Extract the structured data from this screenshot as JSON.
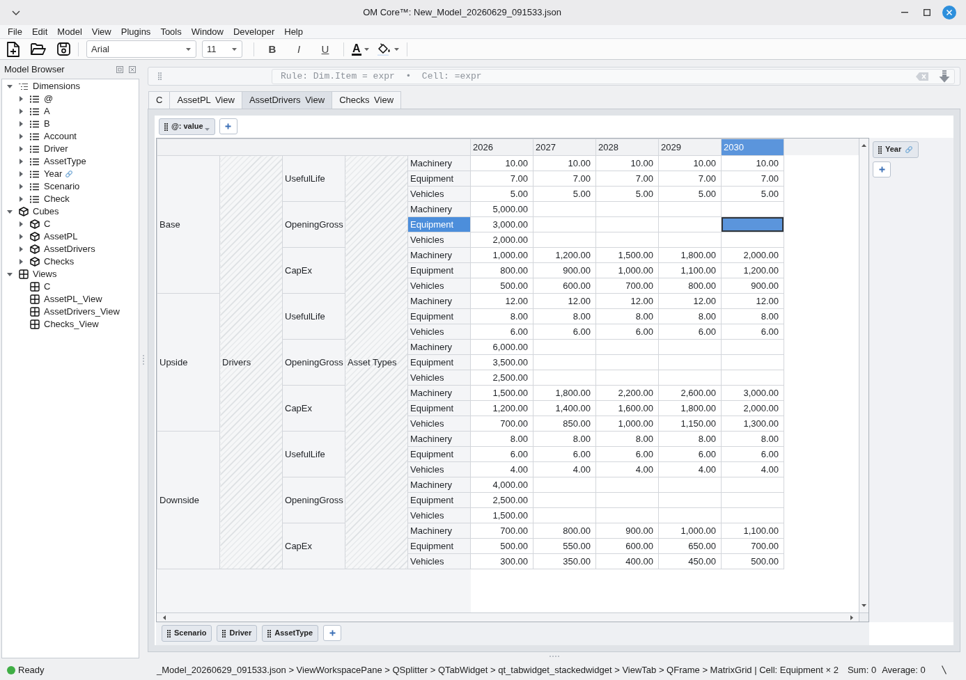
{
  "window": {
    "title": "OM Core™: New_Model_20260629_091533.json"
  },
  "menu": [
    "File",
    "Edit",
    "Model",
    "View",
    "Plugins",
    "Tools",
    "Window",
    "Developer",
    "Help"
  ],
  "toolbar": {
    "font_family": "Arial",
    "font_size": "11",
    "format_buttons": [
      {
        "label": "B",
        "kind": "bold"
      },
      {
        "label": "I",
        "kind": "italic"
      },
      {
        "label": "U",
        "kind": "underline"
      }
    ],
    "text_color_label": "A"
  },
  "model_browser": {
    "title": "Model Browser",
    "tree": [
      {
        "label": "Dimensions",
        "kind": "dimension-group",
        "expanded": true,
        "children": [
          {
            "label": "@",
            "kind": "dimension",
            "expanded": false,
            "linked": false
          },
          {
            "label": "A",
            "kind": "dimension",
            "expanded": false,
            "linked": false
          },
          {
            "label": "B",
            "kind": "dimension",
            "expanded": false,
            "linked": false
          },
          {
            "label": "Account",
            "kind": "dimension",
            "expanded": false,
            "linked": false
          },
          {
            "label": "Driver",
            "kind": "dimension",
            "expanded": false,
            "linked": false
          },
          {
            "label": "AssetType",
            "kind": "dimension",
            "expanded": false,
            "linked": false
          },
          {
            "label": "Year",
            "kind": "dimension",
            "expanded": false,
            "linked": true
          },
          {
            "label": "Scenario",
            "kind": "dimension",
            "expanded": false,
            "linked": false
          },
          {
            "label": "Check",
            "kind": "dimension",
            "expanded": false,
            "linked": false
          }
        ]
      },
      {
        "label": "Cubes",
        "kind": "cube-group",
        "expanded": true,
        "children": [
          {
            "label": "C",
            "kind": "cube",
            "expanded": false
          },
          {
            "label": "AssetPL",
            "kind": "cube",
            "expanded": false
          },
          {
            "label": "AssetDrivers",
            "kind": "cube",
            "expanded": false
          },
          {
            "label": "Checks",
            "kind": "cube",
            "expanded": false
          }
        ]
      },
      {
        "label": "Views",
        "kind": "view-group",
        "expanded": true,
        "children": [
          {
            "label": "C",
            "kind": "view"
          },
          {
            "label": "AssetPL_View",
            "kind": "view"
          },
          {
            "label": "AssetDrivers_View",
            "kind": "view"
          },
          {
            "label": "Checks_View",
            "kind": "view"
          }
        ]
      }
    ]
  },
  "rule_bar": {
    "placeholder": "Rule: Dim.Item = expr  •  Cell: =expr"
  },
  "tabs": [
    {
      "label": "C",
      "selected": false
    },
    {
      "label": "AssetPL View",
      "selected": false
    },
    {
      "label": "AssetDrivers View",
      "selected": true
    },
    {
      "label": "Checks View",
      "selected": false
    }
  ],
  "view": {
    "filters": [
      {
        "label": "@: value"
      }
    ],
    "column_dimensions": [
      {
        "label": "Year",
        "linked": true
      }
    ],
    "row_dimensions": [
      {
        "label": "Scenario",
        "linked": false
      },
      {
        "label": "Driver",
        "linked": false
      },
      {
        "label": "AssetType",
        "linked": false
      }
    ],
    "grid": {
      "columns": [
        {
          "label": "2026",
          "selected": false
        },
        {
          "label": "2027",
          "selected": false
        },
        {
          "label": "2028",
          "selected": false
        },
        {
          "label": "2029",
          "selected": false
        },
        {
          "label": "2030",
          "selected": true
        }
      ],
      "spanning_labels": [
        "Drivers",
        "Asset Types"
      ],
      "scenarios": [
        {
          "label": "Base",
          "drivers": [
            {
              "label": "UsefulLife",
              "rows": [
                {
                  "label": "Machinery",
                  "selected": false,
                  "values": [
                    "10.00",
                    "10.00",
                    "10.00",
                    "10.00",
                    "10.00"
                  ]
                },
                {
                  "label": "Equipment",
                  "selected": false,
                  "values": [
                    "7.00",
                    "7.00",
                    "7.00",
                    "7.00",
                    "7.00"
                  ]
                },
                {
                  "label": "Vehicles",
                  "selected": false,
                  "values": [
                    "5.00",
                    "5.00",
                    "5.00",
                    "5.00",
                    "5.00"
                  ]
                }
              ]
            },
            {
              "label": "OpeningGross",
              "rows": [
                {
                  "label": "Machinery",
                  "selected": false,
                  "values": [
                    "5,000.00"
                  ]
                },
                {
                  "label": "Equipment",
                  "selected": true,
                  "values": [
                    "3,000.00"
                  ]
                },
                {
                  "label": "Vehicles",
                  "selected": false,
                  "values": [
                    "2,000.00"
                  ]
                }
              ]
            },
            {
              "label": "CapEx",
              "rows": [
                {
                  "label": "Machinery",
                  "selected": false,
                  "values": [
                    "1,000.00",
                    "1,200.00",
                    "1,500.00",
                    "1,800.00",
                    "2,000.00"
                  ]
                },
                {
                  "label": "Equipment",
                  "selected": false,
                  "values": [
                    "800.00",
                    "900.00",
                    "1,000.00",
                    "1,100.00",
                    "1,200.00"
                  ]
                },
                {
                  "label": "Vehicles",
                  "selected": false,
                  "values": [
                    "500.00",
                    "600.00",
                    "700.00",
                    "800.00",
                    "900.00"
                  ]
                }
              ]
            }
          ]
        },
        {
          "label": "Upside",
          "drivers": [
            {
              "label": "UsefulLife",
              "rows": [
                {
                  "label": "Machinery",
                  "selected": false,
                  "values": [
                    "12.00",
                    "12.00",
                    "12.00",
                    "12.00",
                    "12.00"
                  ]
                },
                {
                  "label": "Equipment",
                  "selected": false,
                  "values": [
                    "8.00",
                    "8.00",
                    "8.00",
                    "8.00",
                    "8.00"
                  ]
                },
                {
                  "label": "Vehicles",
                  "selected": false,
                  "values": [
                    "6.00",
                    "6.00",
                    "6.00",
                    "6.00",
                    "6.00"
                  ]
                }
              ]
            },
            {
              "label": "OpeningGross",
              "rows": [
                {
                  "label": "Machinery",
                  "selected": false,
                  "values": [
                    "6,000.00"
                  ]
                },
                {
                  "label": "Equipment",
                  "selected": false,
                  "values": [
                    "3,500.00"
                  ]
                },
                {
                  "label": "Vehicles",
                  "selected": false,
                  "values": [
                    "2,500.00"
                  ]
                }
              ]
            },
            {
              "label": "CapEx",
              "rows": [
                {
                  "label": "Machinery",
                  "selected": false,
                  "values": [
                    "1,500.00",
                    "1,800.00",
                    "2,200.00",
                    "2,600.00",
                    "3,000.00"
                  ]
                },
                {
                  "label": "Equipment",
                  "selected": false,
                  "values": [
                    "1,200.00",
                    "1,400.00",
                    "1,600.00",
                    "1,800.00",
                    "2,000.00"
                  ]
                },
                {
                  "label": "Vehicles",
                  "selected": false,
                  "values": [
                    "700.00",
                    "850.00",
                    "1,000.00",
                    "1,150.00",
                    "1,300.00"
                  ]
                }
              ]
            }
          ]
        },
        {
          "label": "Downside",
          "drivers": [
            {
              "label": "UsefulLife",
              "rows": [
                {
                  "label": "Machinery",
                  "selected": false,
                  "values": [
                    "8.00",
                    "8.00",
                    "8.00",
                    "8.00",
                    "8.00"
                  ]
                },
                {
                  "label": "Equipment",
                  "selected": false,
                  "values": [
                    "6.00",
                    "6.00",
                    "6.00",
                    "6.00",
                    "6.00"
                  ]
                },
                {
                  "label": "Vehicles",
                  "selected": false,
                  "values": [
                    "4.00",
                    "4.00",
                    "4.00",
                    "4.00",
                    "4.00"
                  ]
                }
              ]
            },
            {
              "label": "OpeningGross",
              "rows": [
                {
                  "label": "Machinery",
                  "selected": false,
                  "values": [
                    "4,000.00"
                  ]
                },
                {
                  "label": "Equipment",
                  "selected": false,
                  "values": [
                    "2,500.00"
                  ]
                },
                {
                  "label": "Vehicles",
                  "selected": false,
                  "values": [
                    "1,500.00"
                  ]
                }
              ]
            },
            {
              "label": "CapEx",
              "rows": [
                {
                  "label": "Machinery",
                  "selected": false,
                  "values": [
                    "700.00",
                    "800.00",
                    "900.00",
                    "1,000.00",
                    "1,100.00"
                  ]
                },
                {
                  "label": "Equipment",
                  "selected": false,
                  "values": [
                    "500.00",
                    "550.00",
                    "600.00",
                    "650.00",
                    "700.00"
                  ]
                },
                {
                  "label": "Vehicles",
                  "selected": false,
                  "values": [
                    "300.00",
                    "350.00",
                    "400.00",
                    "450.00",
                    "500.00"
                  ]
                }
              ]
            }
          ]
        }
      ]
    }
  },
  "status_bar": {
    "status": "Ready",
    "path": "_Model_20260629_091533.json > ViewWorkspacePane > QSplitter > QTabWidget > qt_tabwidget_stackedwidget > ViewTab > QFrame > MatrixGrid | Cell: Equipment × 2",
    "summary": [
      "Sum: 0",
      "Average: 0"
    ]
  }
}
